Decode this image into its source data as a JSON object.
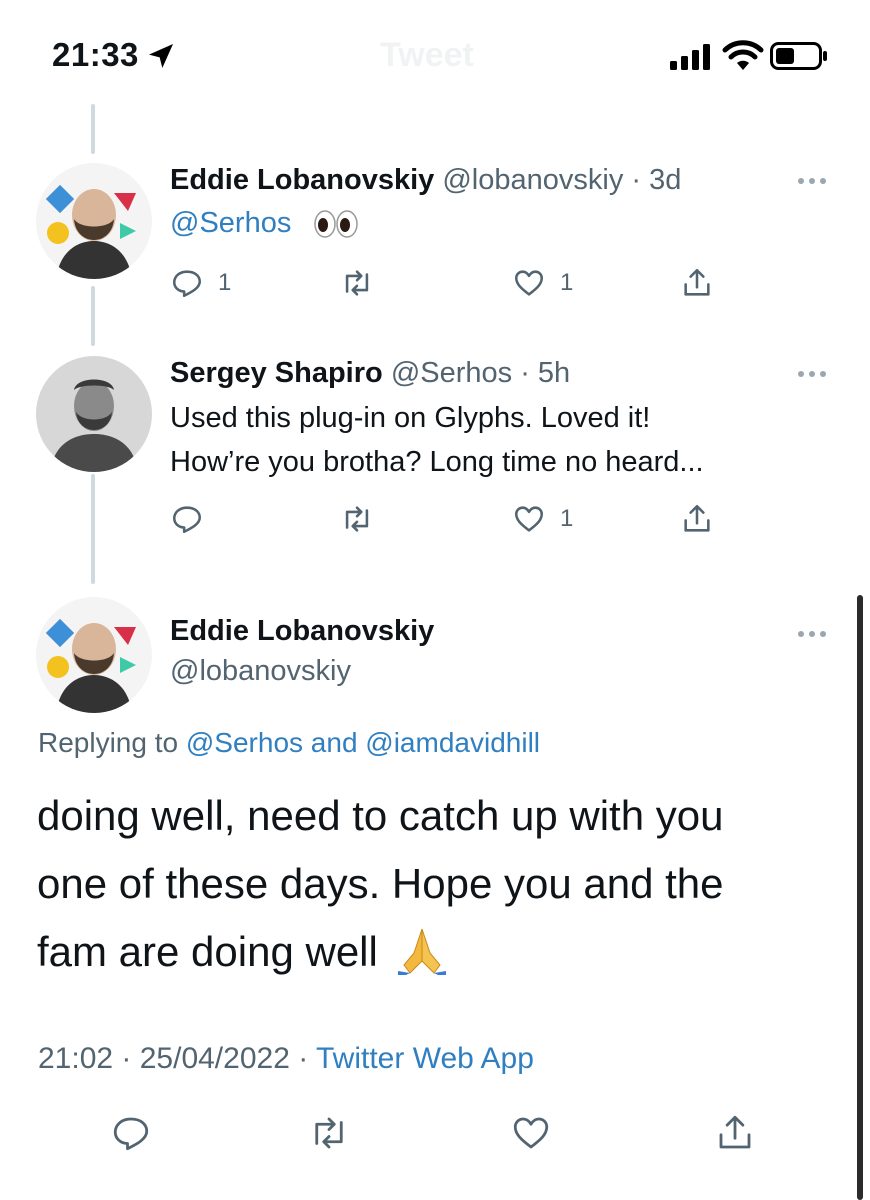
{
  "status_bar": {
    "time": "21:33",
    "faded_title": "Tweet"
  },
  "tweets": [
    {
      "name": "Eddie Lobanovskiy",
      "handle": "@lobanovskiy",
      "age": "· 3d",
      "mention": "@Serhos",
      "emoji": "eyes",
      "reply_count": "1",
      "like_count": "1"
    },
    {
      "name": "Sergey Shapiro",
      "handle": "@Serhos",
      "age": "· 5h",
      "line1": "Used this plug-in on Glyphs. Loved it!",
      "line2": "How’re you brotha? Long time no heard...",
      "like_count": "1"
    }
  ],
  "main_tweet": {
    "name": "Eddie Lobanovskiy",
    "handle": "@lobanovskiy",
    "replying_prefix": "Replying to",
    "replying_to": "@Serhos and @iamdavidhill",
    "line1": "doing well, need to catch up with you",
    "line2": "one of these days. Hope you and the",
    "line3": "fam are doing well",
    "emoji": "folded-hands",
    "time": "21:02 · 25/04/2022 ·",
    "source": "Twitter Web App"
  },
  "colors": {
    "link": "#2f7fc1",
    "muted": "#536471",
    "thread_line": "#cfd9de"
  }
}
